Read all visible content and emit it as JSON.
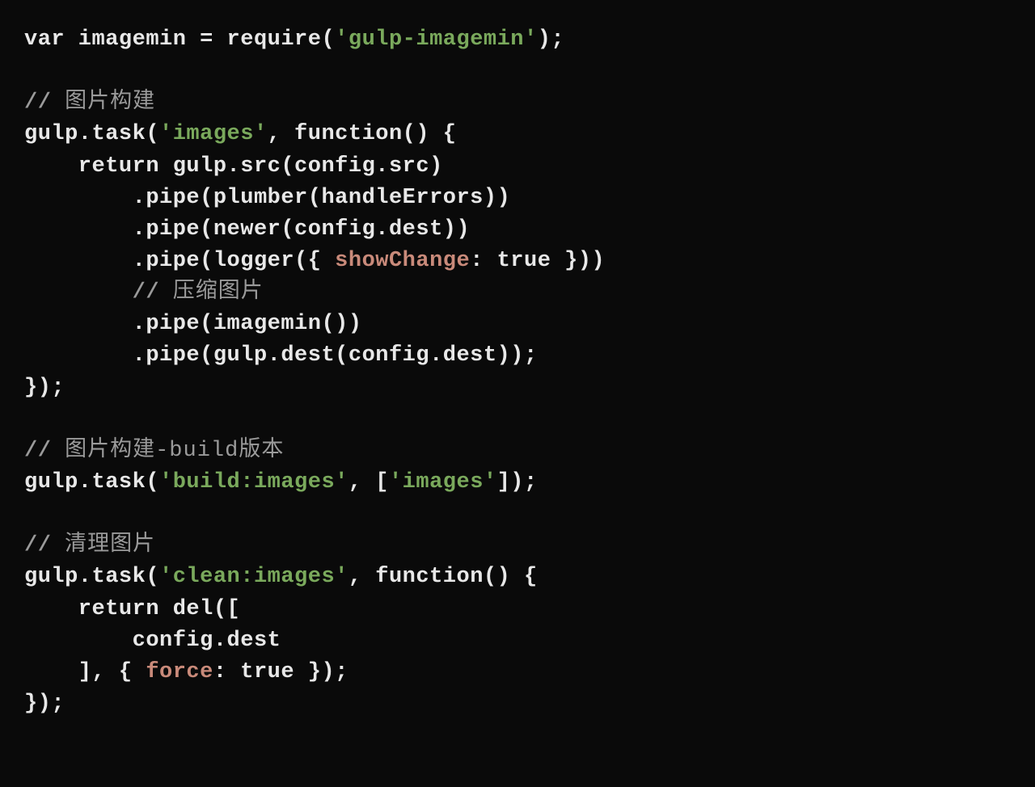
{
  "code": {
    "line1_a": "var imagemin = require(",
    "line1_str": "'gulp-imagemin'",
    "line1_b": ");",
    "blank1": "",
    "line3_com": "// ",
    "line3_com_cjk": "图片构建",
    "line4_a": "gulp.task(",
    "line4_str": "'images'",
    "line4_b": ", function() {",
    "line5": "    return gulp.src(config.src)",
    "line6": "        .pipe(plumber(handleErrors))",
    "line7": "        .pipe(newer(config.dest))",
    "line8_a": "        .pipe(logger({ ",
    "line8_prop": "showChange",
    "line8_b": ": true }))",
    "line9_com": "        // ",
    "line9_com_cjk": "压缩图片",
    "line10": "        .pipe(imagemin())",
    "line11": "        .pipe(gulp.dest(config.dest));",
    "line12": "});",
    "blank2": "",
    "line14_com": "// ",
    "line14_com_cjk": "图片构建-build版本",
    "line15_a": "gulp.task(",
    "line15_str1": "'build:images'",
    "line15_b": ", [",
    "line15_str2": "'images'",
    "line15_c": "]);",
    "blank3": "",
    "line17_com": "// ",
    "line17_com_cjk": "清理图片",
    "line18_a": "gulp.task(",
    "line18_str": "'clean:images'",
    "line18_b": ", function() {",
    "line19": "    return del([",
    "line20": "        config.dest",
    "line21_a": "    ], { ",
    "line21_prop": "force",
    "line21_b": ": true });",
    "line22": "});"
  }
}
